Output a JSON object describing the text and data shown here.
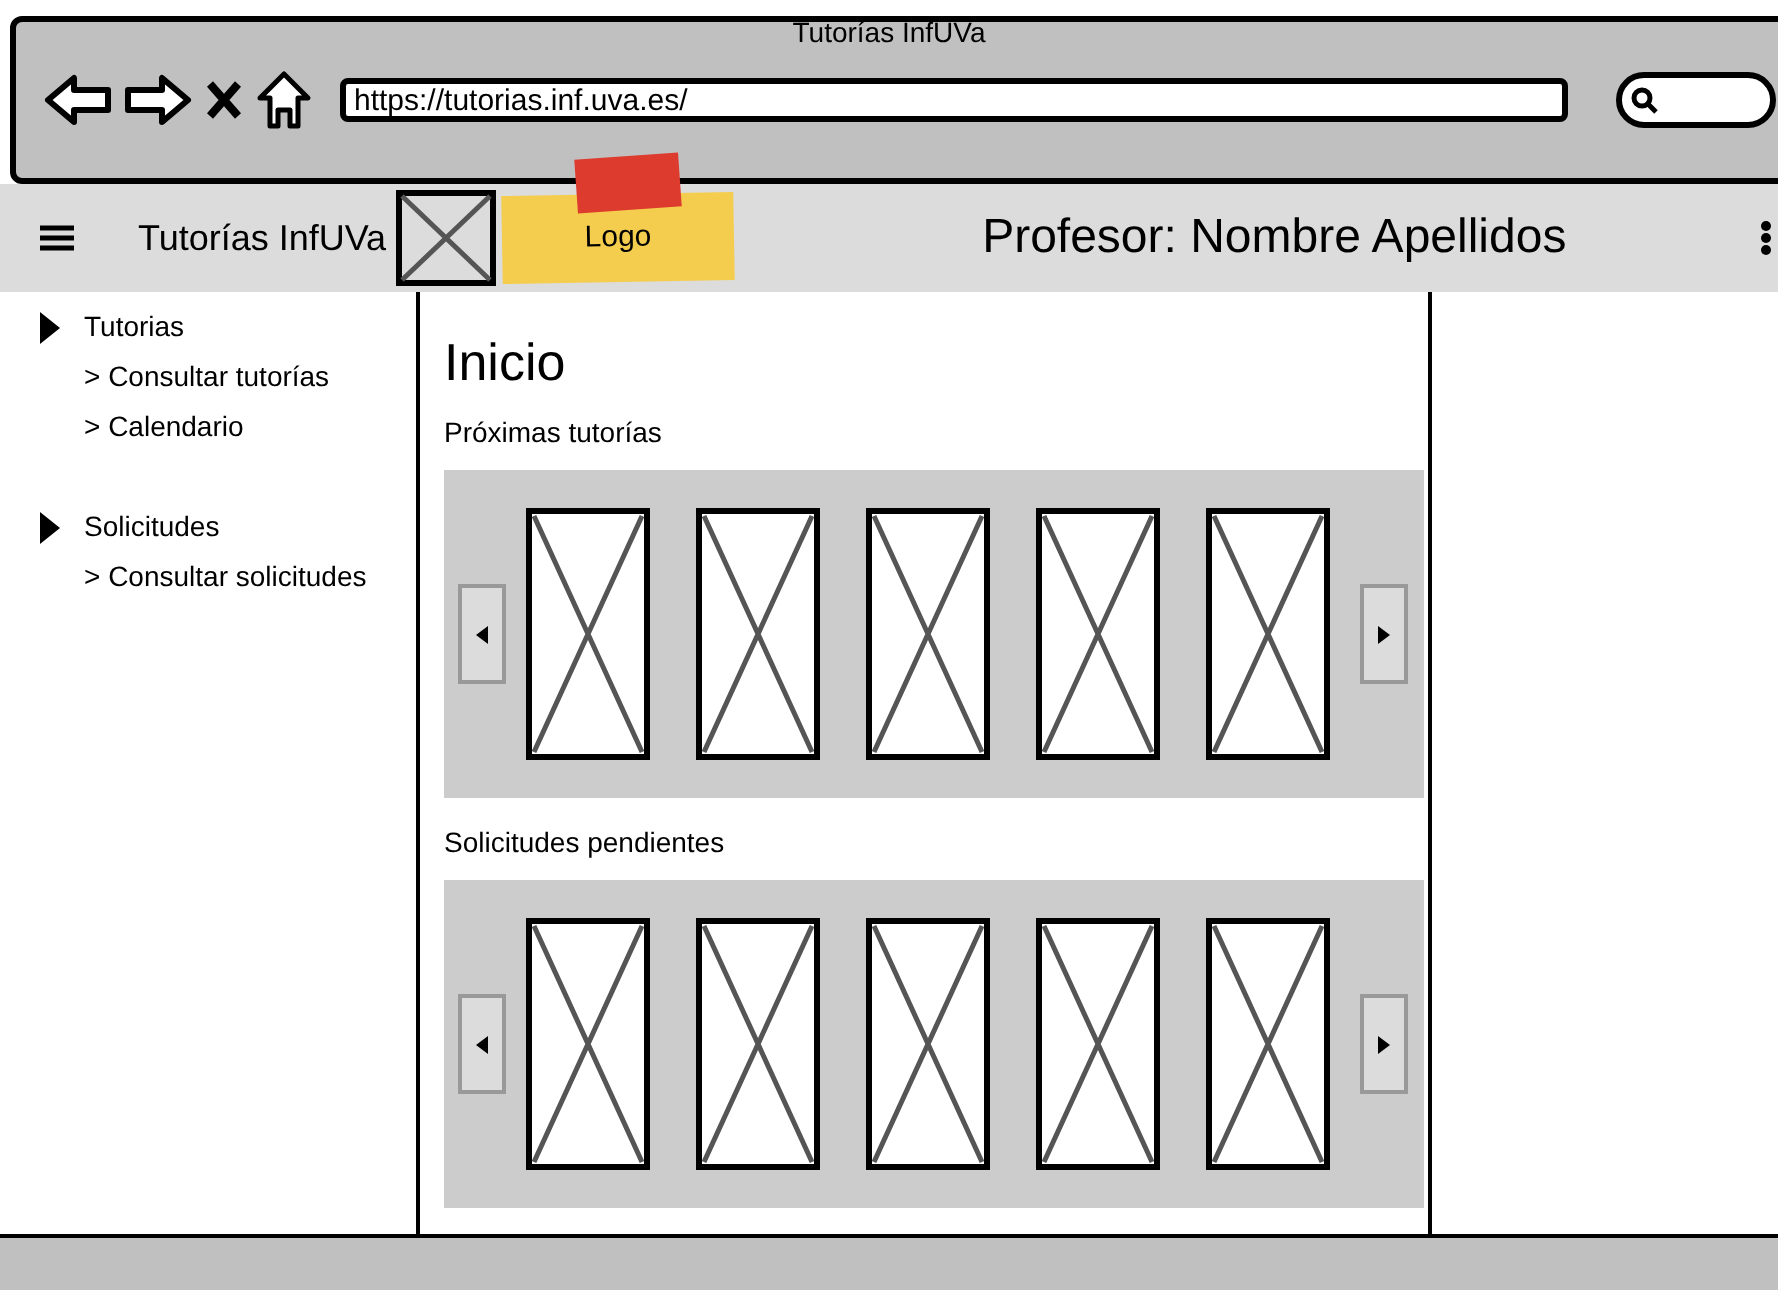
{
  "browser": {
    "title": "Tutorías InfUVa",
    "url": "https://tutorias.inf.uva.es/"
  },
  "header": {
    "app_name": "Tutorías InfUVa",
    "logo_label": "Logo",
    "user": "Profesor: Nombre Apellidos"
  },
  "sidebar": {
    "sections": [
      {
        "label": "Tutorias",
        "items": [
          "> Consultar tutorías",
          "> Calendario"
        ]
      },
      {
        "label": "Solicitudes",
        "items": [
          "> Consultar solicitudes"
        ]
      }
    ]
  },
  "main": {
    "title": "Inicio",
    "carousels": [
      {
        "title": "Próximas tutorías"
      },
      {
        "title": "Solicitudes pendientes"
      }
    ]
  }
}
